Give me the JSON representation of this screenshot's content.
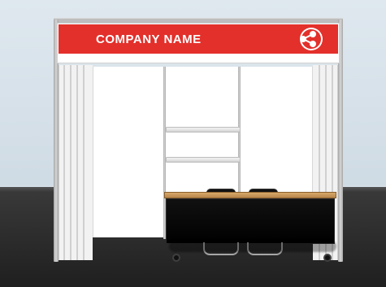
{
  "fascia": {
    "company_name": "COMPANY NAME"
  },
  "icons": {
    "logo": "three-dots-network-logo"
  },
  "colors": {
    "brand_red": "#e3302b",
    "fascia_white": "#ffffff",
    "frame_gray": "#bdbdbd",
    "wall": "#dfe8ef",
    "floor": "#2b2b2b",
    "counter_black": "#000000",
    "counter_wood": "#c6925a"
  }
}
